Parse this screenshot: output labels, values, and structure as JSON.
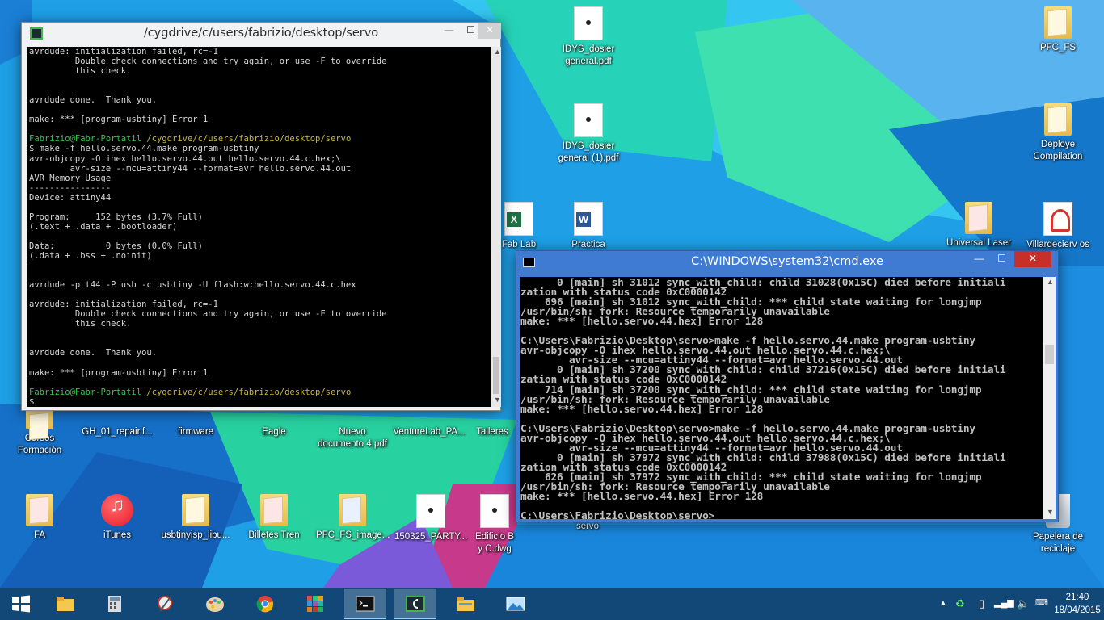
{
  "desktop": {
    "icons": [
      {
        "id": "idys1",
        "label": "IDYS_dosier general.pdf",
        "icon": "pdf-document-icon"
      },
      {
        "id": "idys2",
        "label": "IDYS_dosier general (1).pdf",
        "icon": "pdf-document-icon"
      },
      {
        "id": "fablab",
        "label": "Fab Lab",
        "icon": "excel-document-icon"
      },
      {
        "id": "practica",
        "label": "Práctica",
        "icon": "word-document-icon"
      },
      {
        "id": "pfcfs",
        "label": "PFC_FS",
        "icon": "folder-icon"
      },
      {
        "id": "deploye",
        "label": "Deploye Compilation",
        "icon": "folder-icon"
      },
      {
        "id": "universal",
        "label": "Universal Laser",
        "icon": "pdf-document-icon"
      },
      {
        "id": "villar",
        "label": "Villardecierv os",
        "icon": "pdf-document-icon"
      },
      {
        "id": "cursos",
        "label": "Cursos Formación",
        "icon": "folder-icon"
      },
      {
        "id": "gh01",
        "label": "GH_01_repair.f...",
        "icon": "app-icon"
      },
      {
        "id": "firmware",
        "label": "firmware",
        "icon": "folder-icon"
      },
      {
        "id": "eagle",
        "label": "Eagle",
        "icon": "folder-icon"
      },
      {
        "id": "nuevo",
        "label": "Nuevo documento 4.pdf",
        "icon": "pdf-document-icon"
      },
      {
        "id": "venturelab",
        "label": "VentureLab_PA...",
        "icon": "document-icon"
      },
      {
        "id": "talleres",
        "label": "Talleres",
        "icon": "folder-icon"
      },
      {
        "id": "fa",
        "label": "FA",
        "icon": "folder-icon"
      },
      {
        "id": "itunes",
        "label": "iTunes",
        "icon": "itunes-icon"
      },
      {
        "id": "usbtiny",
        "label": "usbtinyisp_libu...",
        "icon": "folder-icon"
      },
      {
        "id": "billetes",
        "label": "Billetes Tren",
        "icon": "folder-icon"
      },
      {
        "id": "pfcimage",
        "label": "PFC_FS_image...",
        "icon": "folder-icon"
      },
      {
        "id": "party",
        "label": "150325_PARTY...",
        "icon": "image-icon"
      },
      {
        "id": "edificio",
        "label": "Edificio B y C.dwg",
        "icon": "document-icon"
      },
      {
        "id": "servo",
        "label": "servo",
        "icon": "folder-icon"
      },
      {
        "id": "papelera",
        "label": "Papelera de reciclaje",
        "icon": "recycle-bin-icon"
      }
    ]
  },
  "cygwin": {
    "title": "/cygdrive/c/users/fabrizio/desktop/servo",
    "lines": [
      {
        "t": "avrdude: initialization failed, rc=-1",
        "c": "w"
      },
      {
        "t": "         Double check connections and try again, or use -F to override",
        "c": "w"
      },
      {
        "t": "         this check.",
        "c": "w"
      },
      {
        "t": "",
        "c": "w"
      },
      {
        "t": "",
        "c": "w"
      },
      {
        "t": "avrdude done.  Thank you.",
        "c": "w"
      },
      {
        "t": "",
        "c": "w"
      },
      {
        "t": "make: *** [program-usbtiny] Error 1",
        "c": "w"
      },
      {
        "t": "",
        "c": "w"
      },
      {
        "t": "prompt",
        "c": "p"
      },
      {
        "t": "$ make -f hello.servo.44.make program-usbtiny",
        "c": "w"
      },
      {
        "t": "avr-objcopy -O ihex hello.servo.44.out hello.servo.44.c.hex;\\",
        "c": "w"
      },
      {
        "t": "        avr-size --mcu=attiny44 --format=avr hello.servo.44.out",
        "c": "w"
      },
      {
        "t": "AVR Memory Usage",
        "c": "w"
      },
      {
        "t": "----------------",
        "c": "w"
      },
      {
        "t": "Device: attiny44",
        "c": "w"
      },
      {
        "t": "",
        "c": "w"
      },
      {
        "t": "Program:     152 bytes (3.7% Full)",
        "c": "w"
      },
      {
        "t": "(.text + .data + .bootloader)",
        "c": "w"
      },
      {
        "t": "",
        "c": "w"
      },
      {
        "t": "Data:          0 bytes (0.0% Full)",
        "c": "w"
      },
      {
        "t": "(.data + .bss + .noinit)",
        "c": "w"
      },
      {
        "t": "",
        "c": "w"
      },
      {
        "t": "",
        "c": "w"
      },
      {
        "t": "avrdude -p t44 -P usb -c usbtiny -U flash:w:hello.servo.44.c.hex",
        "c": "w"
      },
      {
        "t": "",
        "c": "w"
      },
      {
        "t": "avrdude: initialization failed, rc=-1",
        "c": "w"
      },
      {
        "t": "         Double check connections and try again, or use -F to override",
        "c": "w"
      },
      {
        "t": "         this check.",
        "c": "w"
      },
      {
        "t": "",
        "c": "w"
      },
      {
        "t": "",
        "c": "w"
      },
      {
        "t": "avrdude done.  Thank you.",
        "c": "w"
      },
      {
        "t": "",
        "c": "w"
      },
      {
        "t": "make: *** [program-usbtiny] Error 1",
        "c": "w"
      },
      {
        "t": "",
        "c": "w"
      },
      {
        "t": "prompt",
        "c": "p"
      },
      {
        "t": "$ ",
        "c": "w"
      }
    ],
    "prompt_user": "Fabrizio@Fabr-Portatil",
    "prompt_path": "/cygdrive/c/users/fabrizio/desktop/servo"
  },
  "cmd": {
    "title": "C:\\WINDOWS\\system32\\cmd.exe",
    "lines": [
      "      0 [main] sh 31012 sync_with_child: child 31028(0x15C) died before initiali",
      "zation with status code 0xC0000142",
      "    696 [main] sh 31012 sync_with_child: *** child state waiting for longjmp",
      "/usr/bin/sh: fork: Resource temporarily unavailable",
      "make: *** [hello.servo.44.hex] Error 128",
      "",
      "C:\\Users\\Fabrizio\\Desktop\\servo>make -f hello.servo.44.make program-usbtiny",
      "avr-objcopy -O ihex hello.servo.44.out hello.servo.44.c.hex;\\",
      "        avr-size --mcu=attiny44 --format=avr hello.servo.44.out",
      "      0 [main] sh 37200 sync_with_child: child 37216(0x15C) died before initiali",
      "zation with status code 0xC0000142",
      "    714 [main] sh 37200 sync_with_child: *** child state waiting for longjmp",
      "/usr/bin/sh: fork: Resource temporarily unavailable",
      "make: *** [hello.servo.44.hex] Error 128",
      "",
      "C:\\Users\\Fabrizio\\Desktop\\servo>make -f hello.servo.44.make program-usbtiny",
      "avr-objcopy -O ihex hello.servo.44.out hello.servo.44.c.hex;\\",
      "        avr-size --mcu=attiny44 --format=avr hello.servo.44.out",
      "      0 [main] sh 37972 sync_with_child: child 37988(0x15C) died before initiali",
      "zation with status code 0xC0000142",
      "    626 [main] sh 37972 sync_with_child: *** child state waiting for longjmp",
      "/usr/bin/sh: fork: Resource temporarily unavailable",
      "make: *** [hello.servo.44.hex] Error 128",
      "",
      "C:\\Users\\Fabrizio\\Desktop\\servo>"
    ]
  },
  "taskbar": {
    "apps": [
      {
        "name": "start-button",
        "icon": "windows-logo-icon"
      },
      {
        "name": "taskbar-explorer",
        "icon": "folder-icon"
      },
      {
        "name": "taskbar-calculator",
        "icon": "calculator-icon"
      },
      {
        "name": "taskbar-snipping",
        "icon": "snipping-tool-icon"
      },
      {
        "name": "taskbar-paint",
        "icon": "paint-icon"
      },
      {
        "name": "taskbar-chrome",
        "icon": "chrome-icon"
      },
      {
        "name": "taskbar-apps",
        "icon": "apps-grid-icon"
      },
      {
        "name": "taskbar-cmd",
        "icon": "cmd-icon"
      },
      {
        "name": "taskbar-cygwin",
        "icon": "cygwin-icon"
      },
      {
        "name": "taskbar-file-explorer",
        "icon": "file-explorer-icon"
      },
      {
        "name": "taskbar-photos",
        "icon": "photos-icon"
      }
    ],
    "clock": {
      "time": "21:40",
      "date": "18/04/2015"
    }
  }
}
